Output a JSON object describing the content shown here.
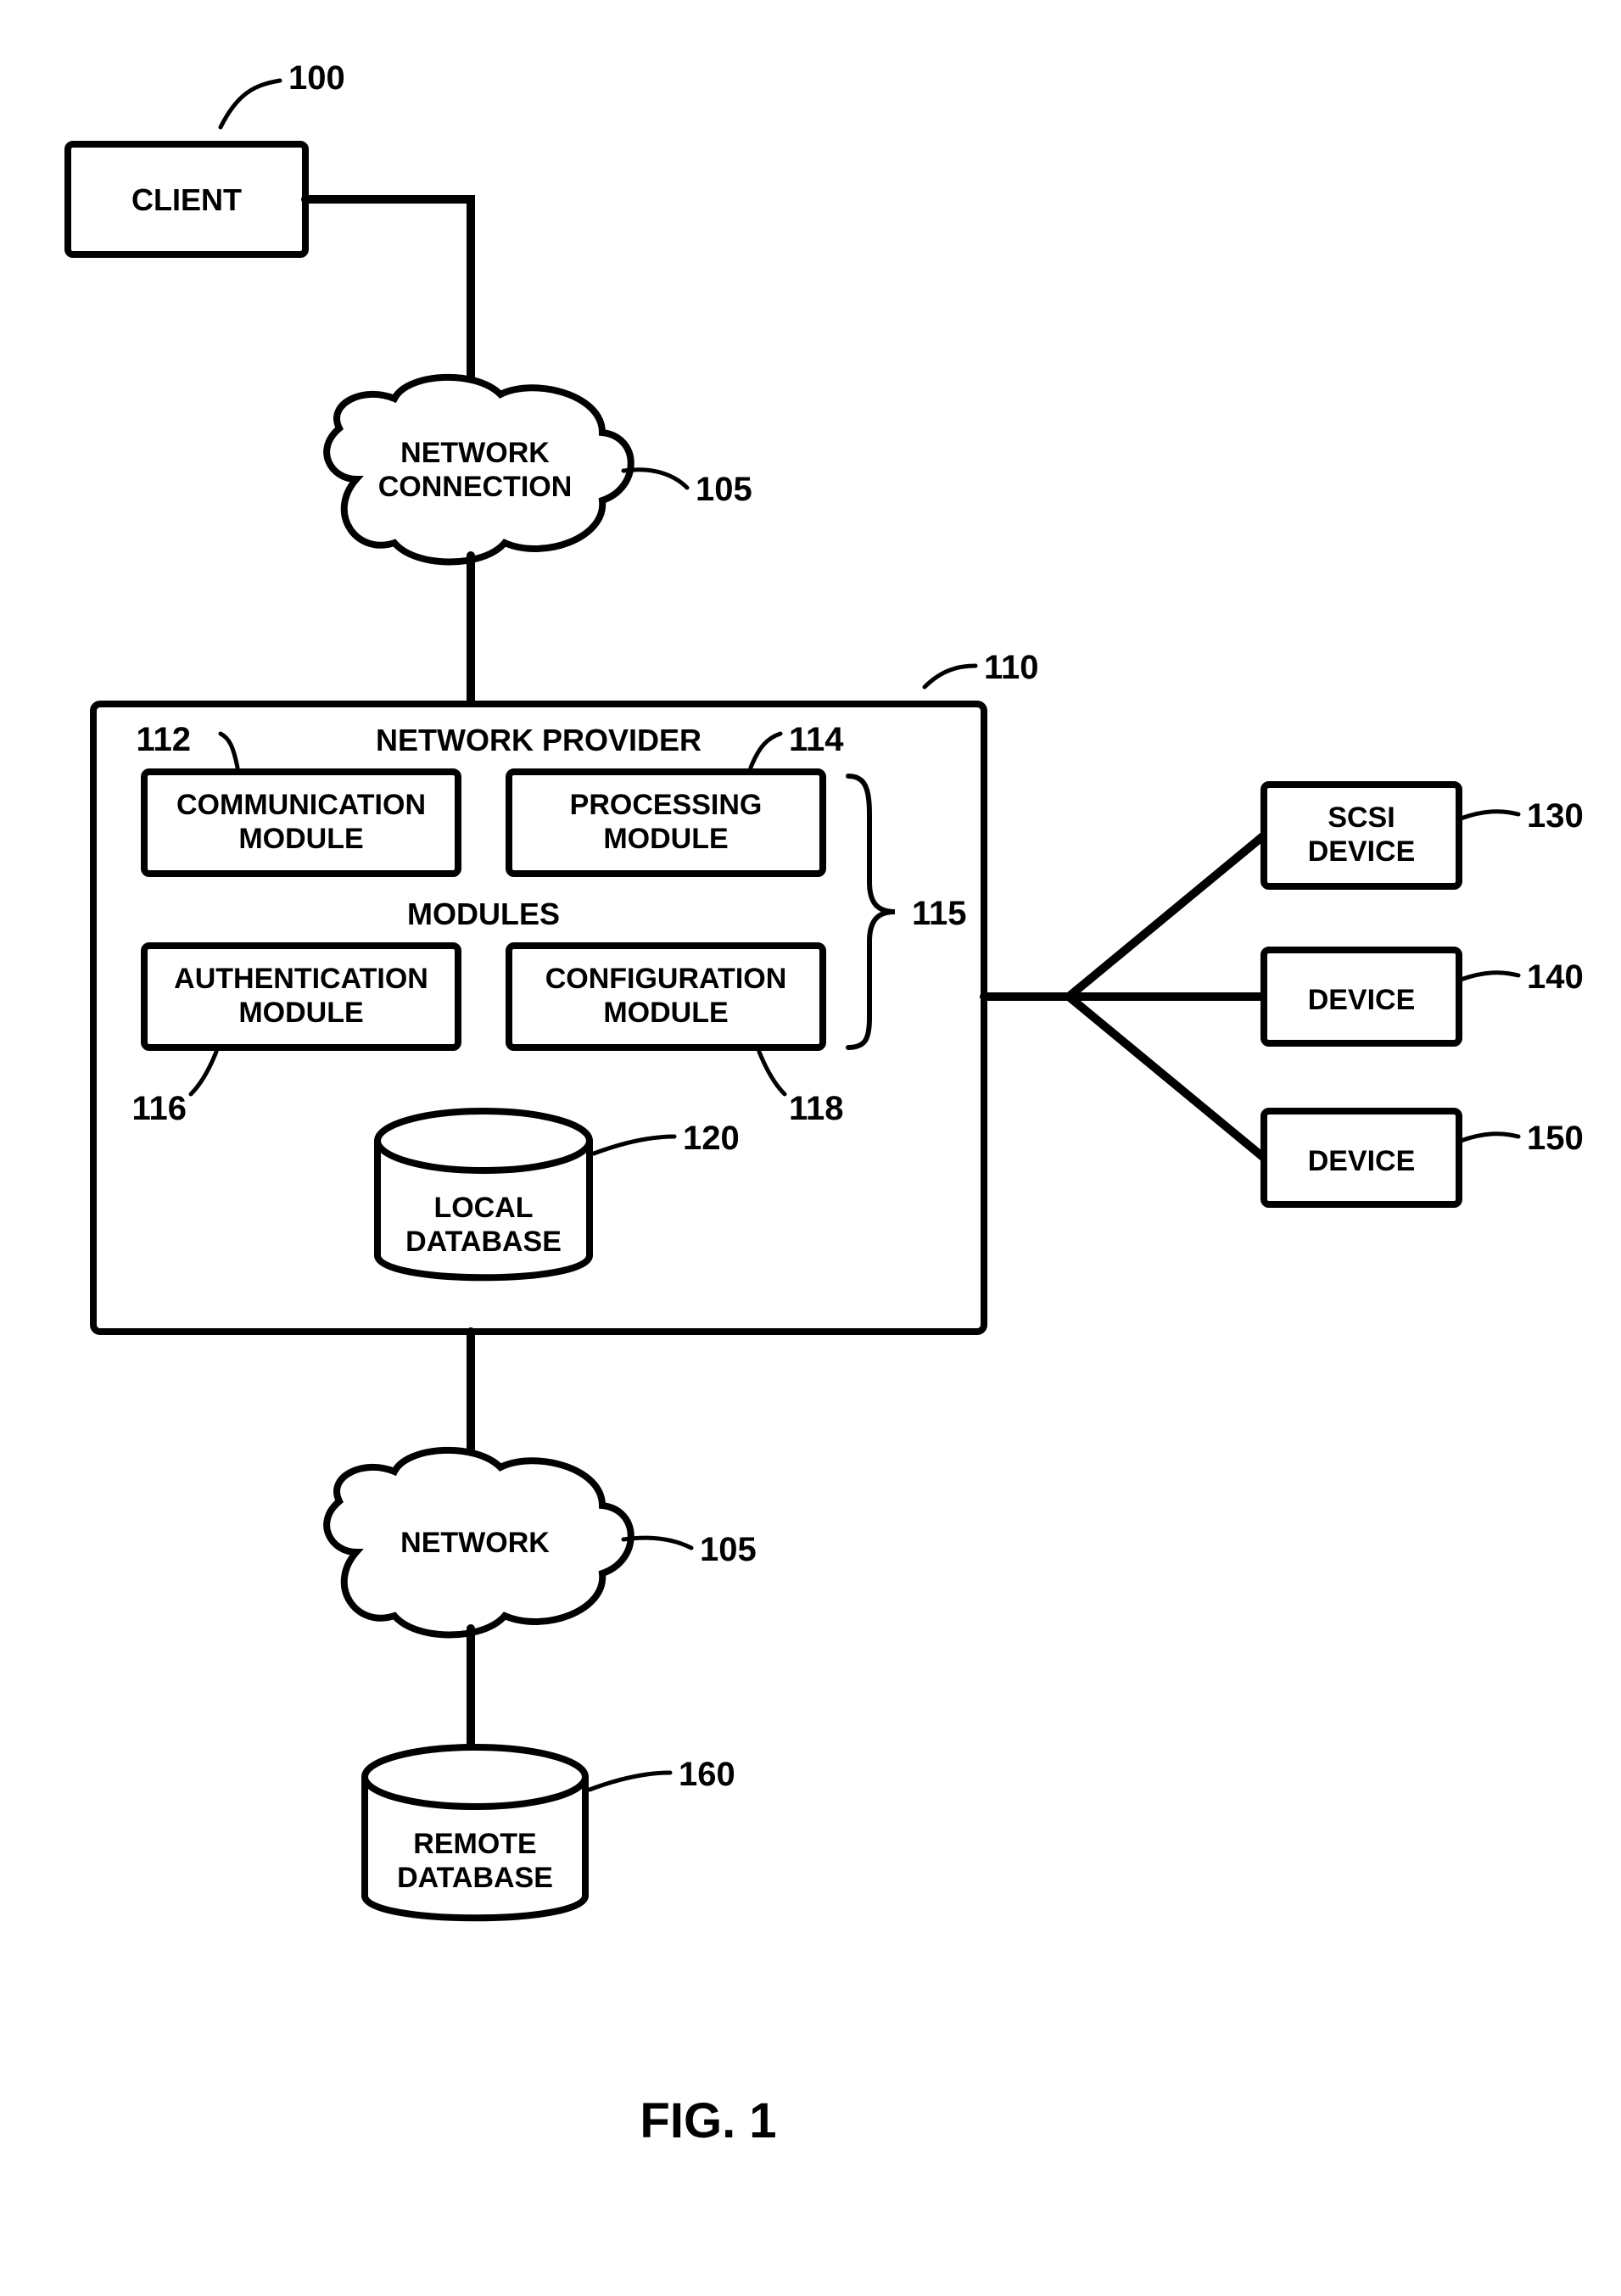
{
  "figure_label": "FIG. 1",
  "client": {
    "label": "CLIENT",
    "ref": "100"
  },
  "cloud_top": {
    "line1": "NETWORK",
    "line2": "CONNECTION",
    "ref": "105"
  },
  "provider": {
    "title": "NETWORK PROVIDER",
    "ref": "110",
    "modules_label": "MODULES",
    "modules_ref": "115",
    "comm": {
      "line1": "COMMUNICATION",
      "line2": "MODULE",
      "ref": "112"
    },
    "proc": {
      "line1": "PROCESSING",
      "line2": "MODULE",
      "ref": "114"
    },
    "auth": {
      "line1": "AUTHENTICATION",
      "line2": "MODULE",
      "ref": "116"
    },
    "config": {
      "line1": "CONFIGURATION",
      "line2": "MODULE",
      "ref": "118"
    },
    "localdb": {
      "line1": "LOCAL",
      "line2": "DATABASE",
      "ref": "120"
    }
  },
  "cloud_bottom": {
    "label": "NETWORK",
    "ref": "105"
  },
  "remotedb": {
    "line1": "REMOTE",
    "line2": "DATABASE",
    "ref": "160"
  },
  "devices": {
    "scsi": {
      "line1": "SCSI",
      "line2": "DEVICE",
      "ref": "130"
    },
    "dev1": {
      "label": "DEVICE",
      "ref": "140"
    },
    "dev2": {
      "label": "DEVICE",
      "ref": "150"
    }
  }
}
